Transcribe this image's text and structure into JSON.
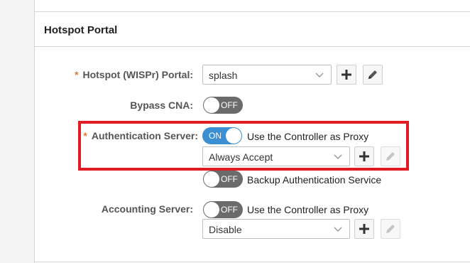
{
  "section": {
    "title": "Hotspot Portal"
  },
  "hotspot_portal": {
    "label": "Hotspot (WISPr) Portal:",
    "required_mark": "*",
    "value": "splash"
  },
  "bypass_cna": {
    "label": "Bypass CNA:",
    "toggle_text": "OFF"
  },
  "authentication_server": {
    "label": "Authentication Server:",
    "required_mark": "*",
    "toggle_text": "ON",
    "proxy_text": "Use the Controller as Proxy",
    "value": "Always Accept",
    "backup_toggle_text": "OFF",
    "backup_text": "Backup Authentication Service"
  },
  "accounting_server": {
    "label": "Accounting Server:",
    "toggle_text": "OFF",
    "proxy_text": "Use the Controller as Proxy",
    "value": "Disable"
  },
  "colors": {
    "toggle_on": "#3b8fd2",
    "toggle_off": "#6b6b6b",
    "required": "#e07a2e",
    "highlight": "#e01b24"
  }
}
